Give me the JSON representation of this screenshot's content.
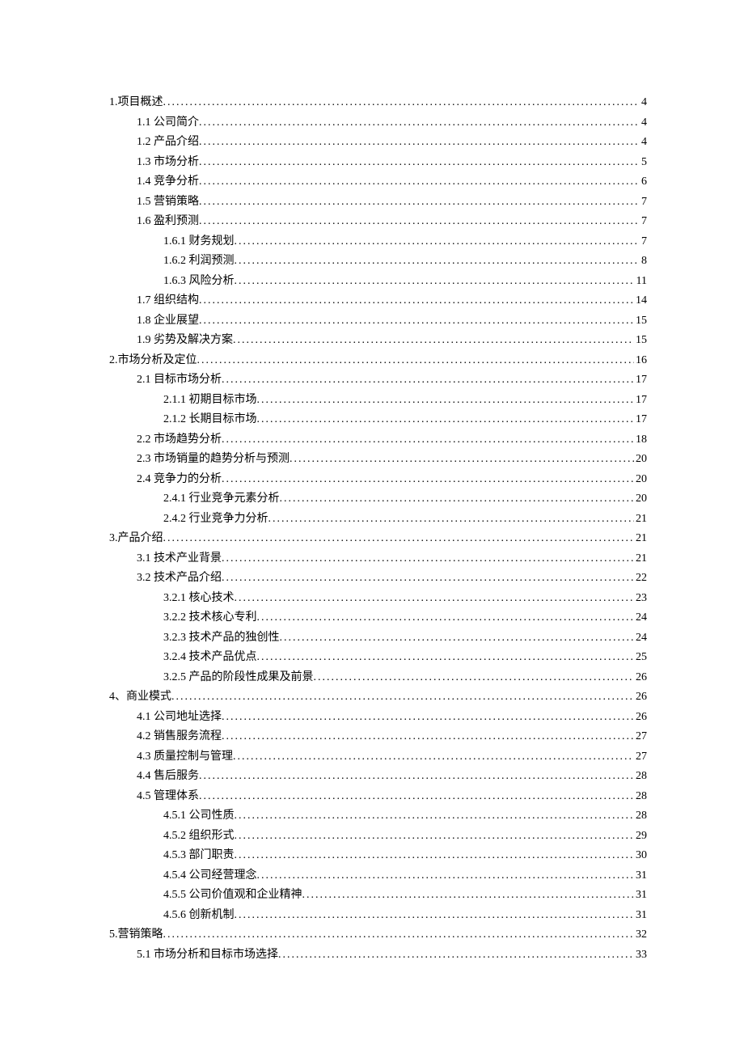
{
  "toc": [
    {
      "level": 1,
      "title": "1.项目概述",
      "page": "4"
    },
    {
      "level": 2,
      "title": "1.1 公司简介",
      "page": "4"
    },
    {
      "level": 2,
      "title": "1.2 产品介绍",
      "page": "4"
    },
    {
      "level": 2,
      "title": "1.3 市场分析",
      "page": "5"
    },
    {
      "level": 2,
      "title": "1.4 竞争分析",
      "page": "6"
    },
    {
      "level": 2,
      "title": "1.5 营销策略",
      "page": "7"
    },
    {
      "level": 2,
      "title": "1.6 盈利预测",
      "page": "7"
    },
    {
      "level": 3,
      "title": "1.6.1 财务规划",
      "page": "7"
    },
    {
      "level": 3,
      "title": "1.6.2  利润预测",
      "page": "8"
    },
    {
      "level": 3,
      "title": "1.6.3 风险分析",
      "page": "11"
    },
    {
      "level": 2,
      "title": "1.7 组织结构",
      "page": "14"
    },
    {
      "level": 2,
      "title": "1.8 企业展望",
      "page": "15"
    },
    {
      "level": 2,
      "title": "1.9 劣势及解决方案",
      "page": "15"
    },
    {
      "level": 1,
      "title": "2.市场分析及定位",
      "page": "16"
    },
    {
      "level": 2,
      "title": "2.1 目标市场分析",
      "page": "17"
    },
    {
      "level": 3,
      "title": "2.1.1 初期目标市场",
      "page": "17"
    },
    {
      "level": 3,
      "title": "2.1.2 长期目标市场",
      "page": "17"
    },
    {
      "level": 2,
      "title": "2.2 市场趋势分析",
      "page": "18"
    },
    {
      "level": 2,
      "title": "2.3 市场销量的趋势分析与预测",
      "page": "20"
    },
    {
      "level": 2,
      "title": "2.4 竞争力的分析",
      "page": "20"
    },
    {
      "level": 3,
      "title": "2.4.1 行业竞争元素分析",
      "page": "20"
    },
    {
      "level": 3,
      "title": "2.4.2 行业竞争力分析",
      "page": "21"
    },
    {
      "level": 1,
      "title": "3.产品介绍",
      "page": "21"
    },
    {
      "level": 2,
      "title": "3.1 技术产业背景",
      "page": "21"
    },
    {
      "level": 2,
      "title": "3.2 技术产品介绍",
      "page": "22"
    },
    {
      "level": 3,
      "title": "3.2.1 核心技术",
      "page": "23"
    },
    {
      "level": 3,
      "title": "3.2.2 技术核心专利",
      "page": "24"
    },
    {
      "level": 3,
      "title": "3.2.3 技术产品的独创性",
      "page": "24"
    },
    {
      "level": 3,
      "title": "3.2.4 技术产品优点",
      "page": "25"
    },
    {
      "level": 3,
      "title": "3.2.5 产品的阶段性成果及前景",
      "page": "26"
    },
    {
      "level": 1,
      "title": "4、商业模式",
      "page": "26"
    },
    {
      "level": 2,
      "title": "4.1 公司地址选择",
      "page": "26"
    },
    {
      "level": 2,
      "title": "4.2 销售服务流程",
      "page": "27"
    },
    {
      "level": 2,
      "title": "4.3 质量控制与管理",
      "page": "27"
    },
    {
      "level": 2,
      "title": "4.4 售后服务",
      "page": "28"
    },
    {
      "level": 2,
      "title": "4.5 管理体系",
      "page": "28"
    },
    {
      "level": 3,
      "title": "4.5.1 公司性质",
      "page": "28"
    },
    {
      "level": 3,
      "title": "4.5.2 组织形式",
      "page": "29"
    },
    {
      "level": 3,
      "title": "4.5.3 部门职责",
      "page": "30"
    },
    {
      "level": 3,
      "title": "4.5.4  公司经营理念",
      "page": "31"
    },
    {
      "level": 3,
      "title": "4.5.5 公司价值观和企业精神",
      "page": "31"
    },
    {
      "level": 3,
      "title": "4.5.6 创新机制",
      "page": "31"
    },
    {
      "level": 1,
      "title": "5.营销策略",
      "page": "32"
    },
    {
      "level": 2,
      "title": "5.1  市场分析和目标市场选择",
      "page": "33"
    }
  ]
}
